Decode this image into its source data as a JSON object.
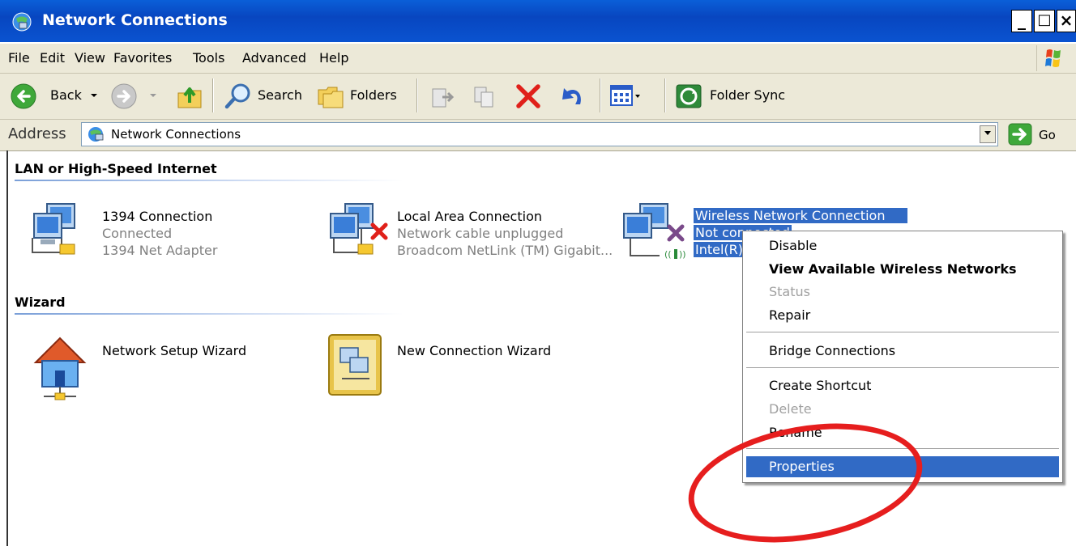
{
  "window": {
    "title": "Network Connections"
  },
  "window_buttons": {
    "minimize": "_",
    "maximize": "□",
    "close": "×"
  },
  "menu": [
    "File",
    "Edit",
    "View",
    "Favorites",
    "Tools",
    "Advanced",
    "Help"
  ],
  "toolbar": {
    "back": "Back",
    "search": "Search",
    "folders": "Folders",
    "folder_sync": "Folder Sync"
  },
  "address": {
    "label": "Address",
    "value": "Network Connections",
    "go": "Go"
  },
  "groups": [
    {
      "header": "LAN or High-Speed Internet",
      "items": [
        {
          "name": "1394 Connection",
          "status": "Connected",
          "device": "1394 Net Adapter",
          "icon": "lan-connection-icon"
        },
        {
          "name": "Local Area Connection",
          "status": "Network cable unplugged",
          "device": "Broadcom NetLink (TM) Gigabit...",
          "icon": "lan-unplugged-icon"
        },
        {
          "name": "Wireless Network Connection",
          "status": "Not connected",
          "device": "Intel(R)",
          "icon": "wireless-connection-icon",
          "selected": true
        }
      ]
    },
    {
      "header": "Wizard",
      "items": [
        {
          "name": "Network Setup Wizard",
          "icon": "network-setup-wizard-icon"
        },
        {
          "name": "New Connection Wizard",
          "icon": "new-connection-wizard-icon"
        }
      ]
    }
  ],
  "context_menu": [
    {
      "label": "Disable",
      "disabled": false,
      "bold": false
    },
    {
      "label": "View Available Wireless Networks",
      "disabled": false,
      "bold": true
    },
    {
      "label": "Status",
      "disabled": true,
      "bold": false
    },
    {
      "label": "Repair",
      "disabled": false,
      "bold": false
    },
    {
      "label": "Bridge Connections",
      "disabled": false,
      "bold": false
    },
    {
      "label": "Create Shortcut",
      "disabled": false,
      "bold": false
    },
    {
      "label": "Delete",
      "disabled": true,
      "bold": false
    },
    {
      "label": "Rename",
      "disabled": false,
      "bold": false
    },
    {
      "label": "Properties",
      "disabled": false,
      "bold": false,
      "highlighted": true
    }
  ],
  "colors": {
    "titlebar": "#0a53d0",
    "selection": "#316ac5",
    "annotation": "#e61e1e",
    "chrome": "#ece9d8"
  }
}
